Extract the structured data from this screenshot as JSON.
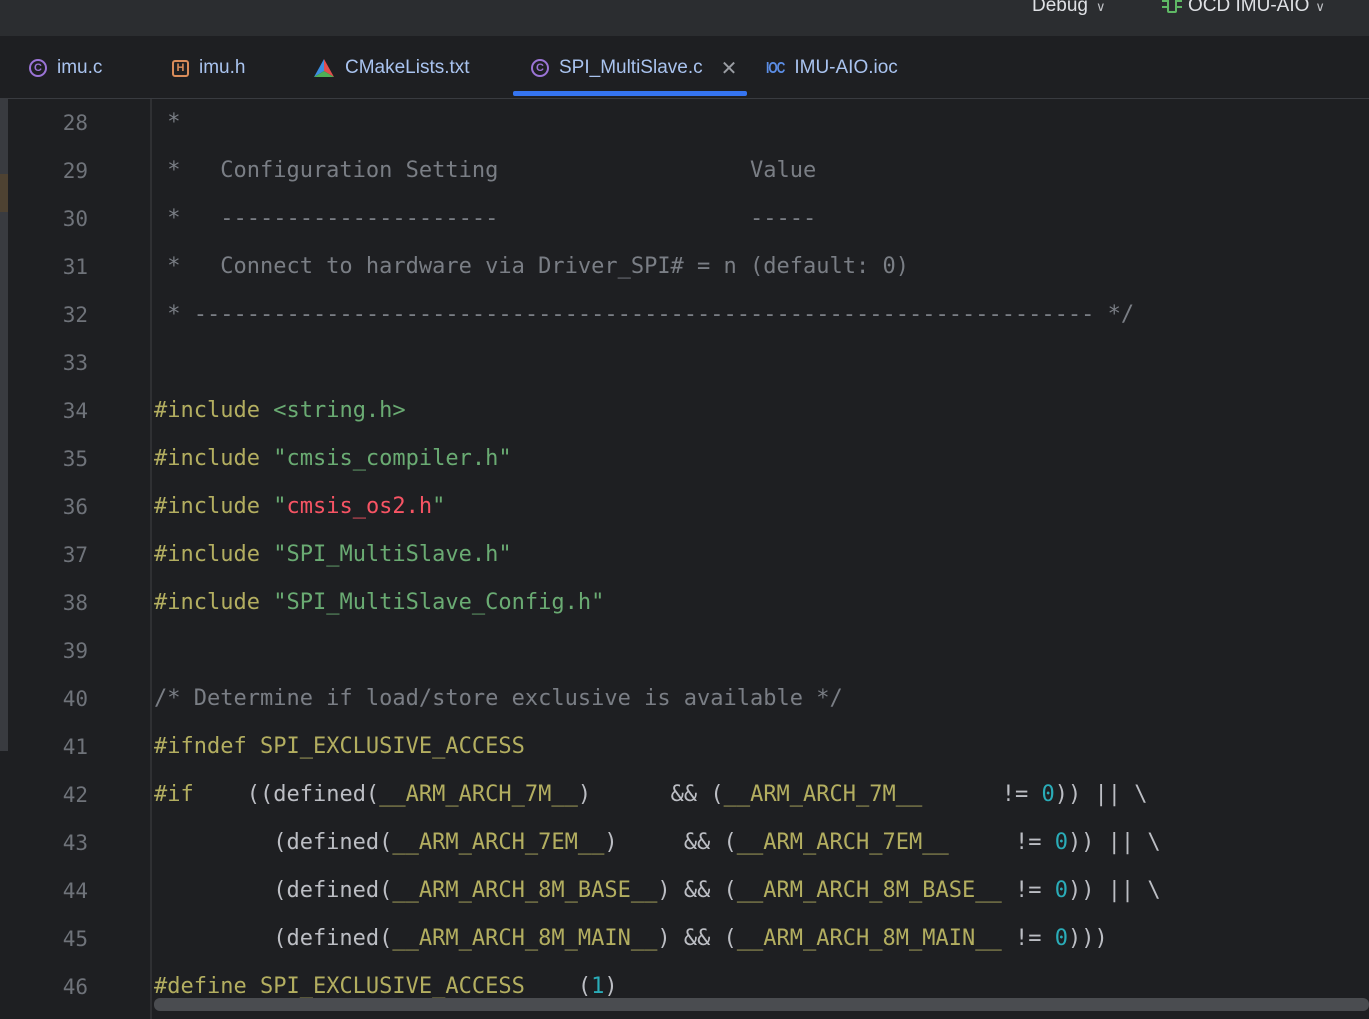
{
  "topbar": {
    "run_config": "Debug",
    "device": "OCD IMU-AIO"
  },
  "tabs": [
    {
      "label": "imu.c",
      "icon": "c-file-icon",
      "active": false
    },
    {
      "label": "imu.h",
      "icon": "h-file-icon",
      "active": false
    },
    {
      "label": "CMakeLists.txt",
      "icon": "cmake-icon",
      "active": false
    },
    {
      "label": "SPI_MultiSlave.c",
      "icon": "c-file-icon",
      "active": true
    },
    {
      "label": "IMU-AIO.ioc",
      "icon": "ioc-file-icon",
      "active": false
    }
  ],
  "icons": {
    "ioc_glyph": "IOC",
    "c_glyph": "C",
    "h_glyph": "H"
  },
  "colors": {
    "accent": "#3574f0",
    "comment": "#7a7e85",
    "string": "#6aab73",
    "directive": "#b3ae60",
    "number": "#2aacb8",
    "error": "#f75464"
  },
  "editor": {
    "lines": [
      {
        "num": "28",
        "tokens": [
          {
            "t": " *",
            "c": "comment"
          }
        ]
      },
      {
        "num": "29",
        "tokens": [
          {
            "t": " *   Configuration Setting                   Value",
            "c": "comment"
          }
        ]
      },
      {
        "num": "30",
        "tokens": [
          {
            "t": " *   ---------------------                   -----",
            "c": "comment"
          }
        ]
      },
      {
        "num": "31",
        "tokens": [
          {
            "t": " *   Connect to hardware via Driver_SPI# = n (default: 0)",
            "c": "comment"
          }
        ]
      },
      {
        "num": "32",
        "tokens": [
          {
            "t": " * -------------------------------------------------------------------- */",
            "c": "comment"
          }
        ]
      },
      {
        "num": "33",
        "tokens": []
      },
      {
        "num": "34",
        "tokens": [
          {
            "t": "#include ",
            "c": "directive"
          },
          {
            "t": "<string.h>",
            "c": "string"
          }
        ]
      },
      {
        "num": "35",
        "tokens": [
          {
            "t": "#include ",
            "c": "directive"
          },
          {
            "t": "\"cmsis_compiler.h\"",
            "c": "string"
          }
        ]
      },
      {
        "num": "36",
        "tokens": [
          {
            "t": "#include ",
            "c": "directive"
          },
          {
            "t": "\"",
            "c": "string"
          },
          {
            "t": "cmsis_os2.h",
            "c": "error"
          },
          {
            "t": "\"",
            "c": "string"
          }
        ]
      },
      {
        "num": "37",
        "tokens": [
          {
            "t": "#include ",
            "c": "directive"
          },
          {
            "t": "\"SPI_MultiSlave.h\"",
            "c": "string"
          }
        ]
      },
      {
        "num": "38",
        "tokens": [
          {
            "t": "#include ",
            "c": "directive"
          },
          {
            "t": "\"SPI_MultiSlave_Config.h\"",
            "c": "string"
          }
        ]
      },
      {
        "num": "39",
        "tokens": []
      },
      {
        "num": "40",
        "tokens": [
          {
            "t": "/* Determine if load/store exclusive is available */",
            "c": "comment"
          }
        ]
      },
      {
        "num": "41",
        "tokens": [
          {
            "t": "#ifndef ",
            "c": "directive"
          },
          {
            "t": "SPI_EXCLUSIVE_ACCESS",
            "c": "macro"
          }
        ]
      },
      {
        "num": "42",
        "tokens": [
          {
            "t": "#if",
            "c": "directive"
          },
          {
            "t": "    ((defined(",
            "c": "plain"
          },
          {
            "t": "__ARM_ARCH_7M__",
            "c": "macro"
          },
          {
            "t": ")      && (",
            "c": "plain"
          },
          {
            "t": "__ARM_ARCH_7M__",
            "c": "macro"
          },
          {
            "t": "      != ",
            "c": "plain"
          },
          {
            "t": "0",
            "c": "number"
          },
          {
            "t": ")) || \\",
            "c": "plain"
          }
        ]
      },
      {
        "num": "43",
        "tokens": [
          {
            "t": "         (defined(",
            "c": "plain"
          },
          {
            "t": "__ARM_ARCH_7EM__",
            "c": "macro"
          },
          {
            "t": ")     && (",
            "c": "plain"
          },
          {
            "t": "__ARM_ARCH_7EM__",
            "c": "macro"
          },
          {
            "t": "     != ",
            "c": "plain"
          },
          {
            "t": "0",
            "c": "number"
          },
          {
            "t": ")) || \\",
            "c": "plain"
          }
        ]
      },
      {
        "num": "44",
        "tokens": [
          {
            "t": "         (defined(",
            "c": "plain"
          },
          {
            "t": "__ARM_ARCH_8M_BASE__",
            "c": "macro"
          },
          {
            "t": ") && (",
            "c": "plain"
          },
          {
            "t": "__ARM_ARCH_8M_BASE__",
            "c": "macro"
          },
          {
            "t": " != ",
            "c": "plain"
          },
          {
            "t": "0",
            "c": "number"
          },
          {
            "t": ")) || \\",
            "c": "plain"
          }
        ]
      },
      {
        "num": "45",
        "tokens": [
          {
            "t": "         (defined(",
            "c": "plain"
          },
          {
            "t": "__ARM_ARCH_8M_MAIN__",
            "c": "macro"
          },
          {
            "t": ") && (",
            "c": "plain"
          },
          {
            "t": "__ARM_ARCH_8M_MAIN__",
            "c": "macro"
          },
          {
            "t": " != ",
            "c": "plain"
          },
          {
            "t": "0",
            "c": "number"
          },
          {
            "t": ")))",
            "c": "plain"
          }
        ]
      },
      {
        "num": "46",
        "tokens": [
          {
            "t": "#define ",
            "c": "directive"
          },
          {
            "t": "SPI_EXCLUSIVE_ACCESS",
            "c": "macro"
          },
          {
            "t": "    (",
            "c": "plain"
          },
          {
            "t": "1",
            "c": "number"
          },
          {
            "t": ")",
            "c": "plain"
          }
        ]
      }
    ]
  }
}
